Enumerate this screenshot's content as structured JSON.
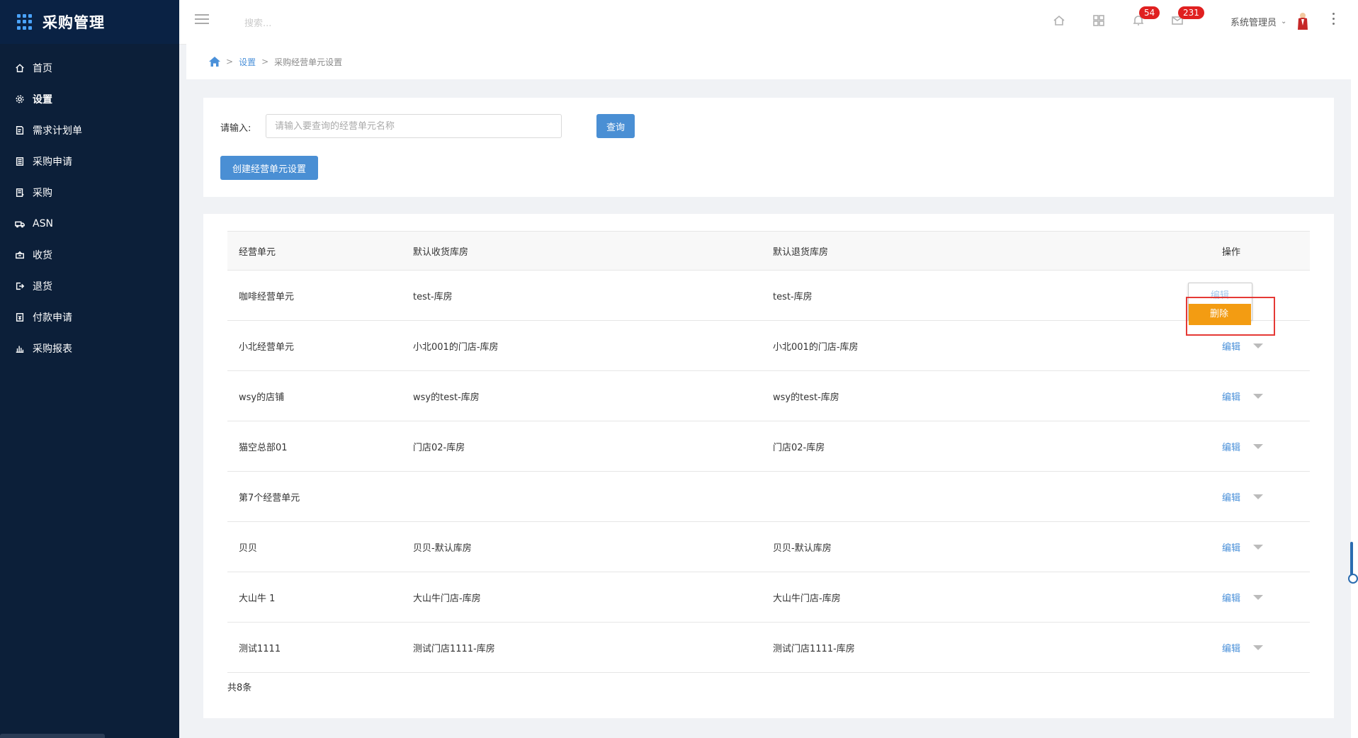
{
  "app": {
    "title": "采购管理"
  },
  "sidebar": {
    "items": [
      {
        "label": "首页",
        "icon": "home-icon"
      },
      {
        "label": "设置",
        "icon": "gear-icon"
      },
      {
        "label": "需求计划单",
        "icon": "document-edit-icon"
      },
      {
        "label": "采购申请",
        "icon": "clipboard-icon"
      },
      {
        "label": "采购",
        "icon": "list-icon"
      },
      {
        "label": "ASN",
        "icon": "truck-icon"
      },
      {
        "label": "收货",
        "icon": "inbox-icon"
      },
      {
        "label": "退货",
        "icon": "return-icon"
      },
      {
        "label": "付款申请",
        "icon": "payment-icon"
      },
      {
        "label": "采购报表",
        "icon": "bar-chart-icon"
      }
    ]
  },
  "topbar": {
    "search_placeholder": "搜索...",
    "notifications_count": "54",
    "messages_count": "231",
    "user_name": "系统管理员"
  },
  "breadcrumb": {
    "level1": "设置",
    "current": "采购经营单元设置"
  },
  "search": {
    "label": "请输入:",
    "placeholder": "请输入要查询的经营单元名称",
    "query_button": "查询",
    "create_button": "创建经营单元设置"
  },
  "table": {
    "headers": [
      "经营单元",
      "默认收货库房",
      "默认退货库房",
      "操作"
    ],
    "rows": [
      {
        "unit": "咖啡经营单元",
        "receive": "test-库房",
        "return": "test-库房"
      },
      {
        "unit": "小北经营单元",
        "receive": "小北001的门店-库房",
        "return": "小北001的门店-库房"
      },
      {
        "unit": "wsy的店铺",
        "receive": "wsy的test-库房",
        "return": "wsy的test-库房"
      },
      {
        "unit": "猫空总部01",
        "receive": "门店02-库房",
        "return": "门店02-库房"
      },
      {
        "unit": "第7个经营单元",
        "receive": "",
        "return": ""
      },
      {
        "unit": "贝贝",
        "receive": "贝贝-默认库房",
        "return": "贝贝-默认库房"
      },
      {
        "unit": "大山牛 1",
        "receive": "大山牛门店-库房",
        "return": "大山牛门店-库房"
      },
      {
        "unit": "测试1111",
        "receive": "测试门店1111-库房",
        "return": "测试门店1111-库房"
      }
    ],
    "edit_label": "编辑",
    "delete_label": "删除",
    "total": "共8条"
  }
}
